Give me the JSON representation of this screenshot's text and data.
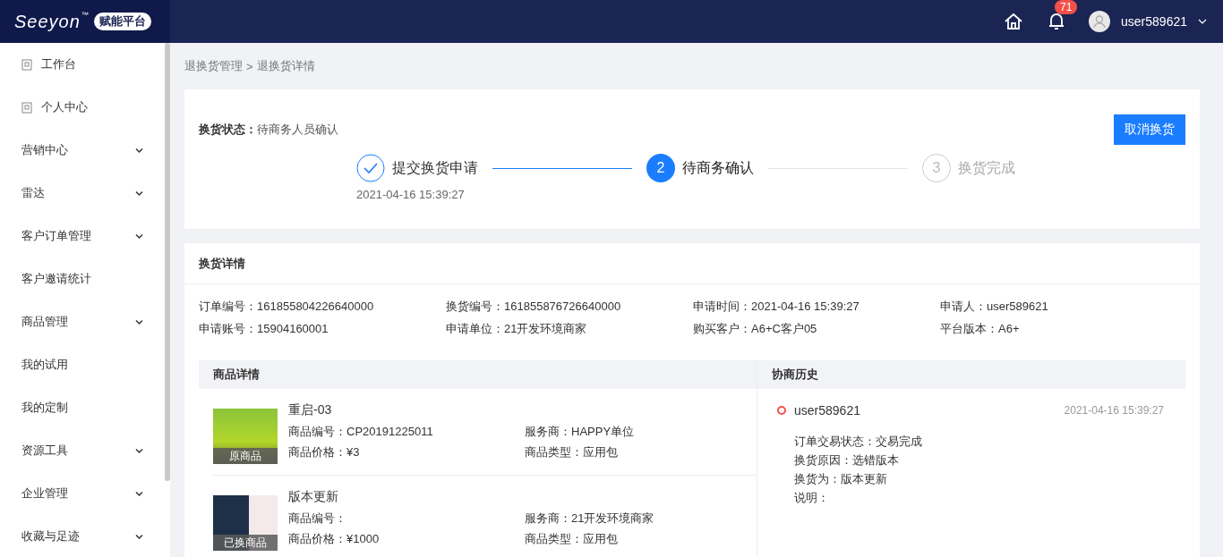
{
  "header": {
    "logo": "Seeyon",
    "trademark": "™",
    "platform_badge": "赋能平台",
    "notification_count": "71",
    "username": "user589621"
  },
  "sidebar": {
    "items": [
      {
        "label": "工作台",
        "kind": "icon-link"
      },
      {
        "label": "个人中心",
        "kind": "icon-link"
      },
      {
        "label": "营销中心",
        "kind": "group"
      },
      {
        "label": "雷达",
        "kind": "group"
      },
      {
        "label": "客户订单管理",
        "kind": "group"
      },
      {
        "label": "客户邀请统计",
        "kind": "link"
      },
      {
        "label": "商品管理",
        "kind": "group"
      },
      {
        "label": "我的试用",
        "kind": "link"
      },
      {
        "label": "我的定制",
        "kind": "link"
      },
      {
        "label": "资源工具",
        "kind": "group"
      },
      {
        "label": "企业管理",
        "kind": "group"
      },
      {
        "label": "收藏与足迹",
        "kind": "group"
      }
    ]
  },
  "breadcrumb": [
    "退换货管理",
    "退换货详情"
  ],
  "breadcrumb_separator": ">",
  "status": {
    "label": "换货状态：",
    "value": "待商务人员确认",
    "cancel_button": "取消换货"
  },
  "steps": [
    {
      "title": "提交换货申请",
      "time": "2021-04-16 15:39:27",
      "completed": true,
      "current": false
    },
    {
      "number": "2",
      "title": "待商务确认",
      "completed": false,
      "current": true
    },
    {
      "number": "3",
      "title": "换货完成",
      "completed": false,
      "current": false
    }
  ],
  "details": {
    "title": "换货详情",
    "fields": [
      {
        "label": "订单编号：",
        "value": "161855804226640000"
      },
      {
        "label": "换货编号：",
        "value": "161855876726640000"
      },
      {
        "label": "申请时间：",
        "value": "2021-04-16 15:39:27"
      },
      {
        "label": "申请人：",
        "value": "user589621"
      },
      {
        "label": "申请账号：",
        "value": "15904160001"
      },
      {
        "label": "申请单位：",
        "value": "21开发环境商家"
      },
      {
        "label": "购买客户：",
        "value": "A6+C客户05"
      },
      {
        "label": "平台版本：",
        "value": "A6+"
      }
    ]
  },
  "products": {
    "title": "商品详情",
    "items": [
      {
        "name": "重启-03",
        "image_label": "原商品",
        "kind": "original",
        "fields": [
          {
            "label": "商品编号：",
            "value": "CP20191225011"
          },
          {
            "label": "服务商：",
            "value": "HAPPY单位"
          },
          {
            "label": "商品价格：",
            "value": "¥3"
          },
          {
            "label": "商品类型：",
            "value": "应用包"
          }
        ]
      },
      {
        "name": "版本更新",
        "image_label": "已换商品",
        "kind": "screenshot",
        "fields": [
          {
            "label": "商品编号："
          },
          {
            "label": "服务商：",
            "value": "21开发环境商家"
          },
          {
            "label": "商品价格：",
            "value": "¥1000"
          },
          {
            "label": "商品类型：",
            "value": "应用包"
          }
        ]
      }
    ]
  },
  "history": {
    "title": "协商历史",
    "entries": [
      {
        "user": "user589621",
        "time": "2021-04-16 15:39:27",
        "color": "#f5504a",
        "lines": [
          "订单交易状态：交易完成",
          "换货原因：选错版本",
          "换货为：版本更新",
          "说明："
        ]
      }
    ]
  }
}
